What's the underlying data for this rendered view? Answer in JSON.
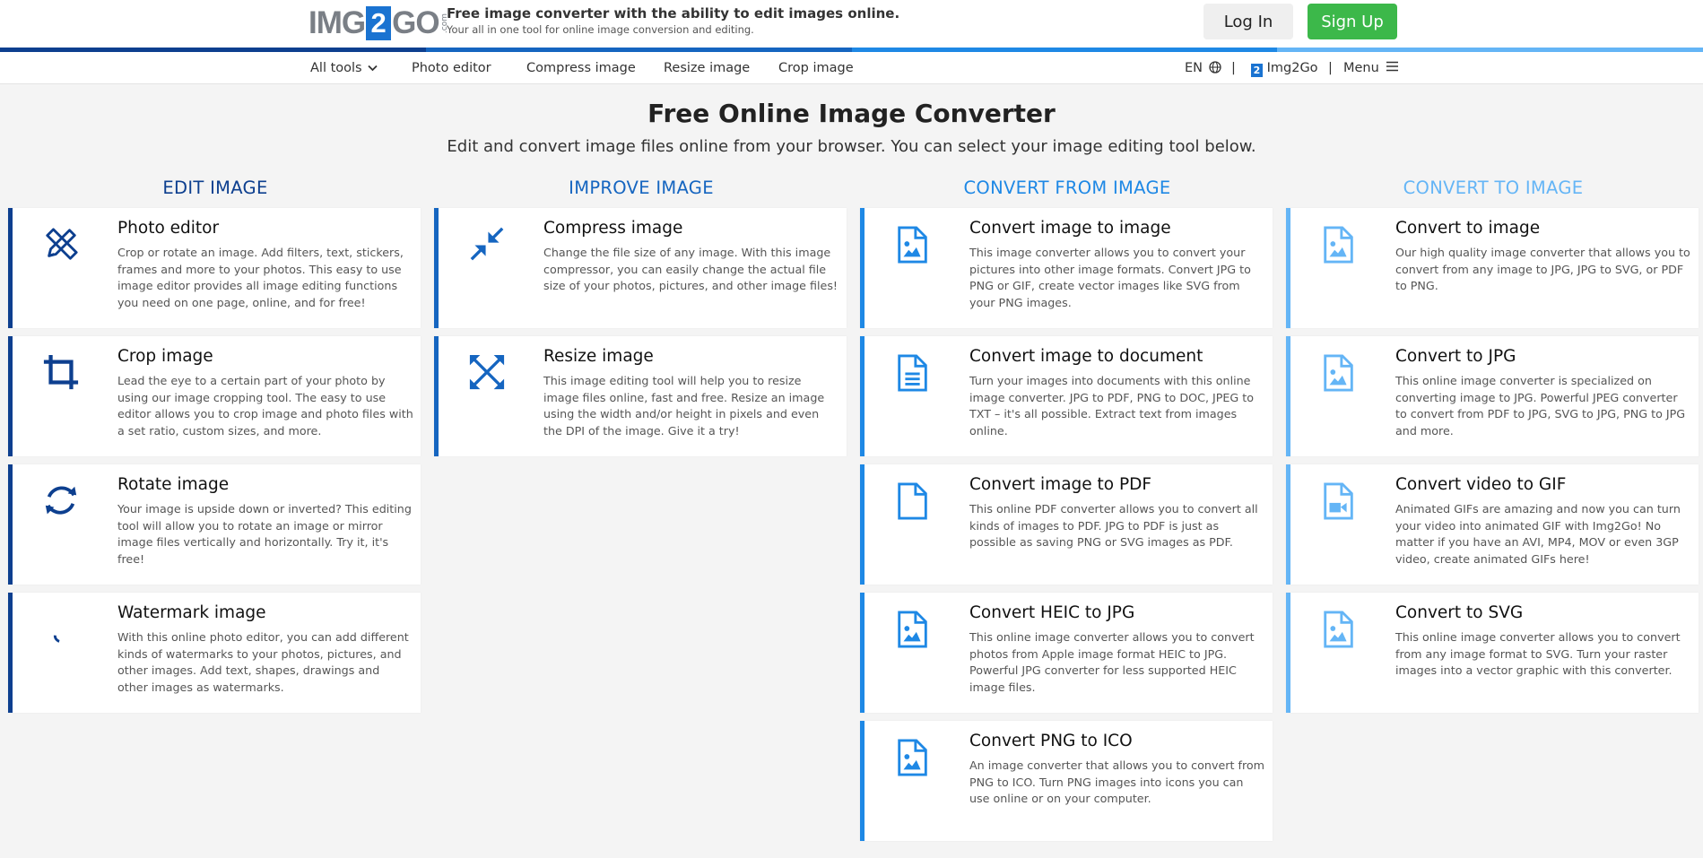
{
  "header": {
    "logo": {
      "pre": "IMG",
      "num": "2",
      "post": "GO",
      "suffix": ".com"
    },
    "tagline_main": "Free image converter with the ability to edit images online.",
    "tagline_sub": "Your all in one tool for online image conversion and editing.",
    "login_label": "Log In",
    "signup_label": "Sign Up"
  },
  "nav": {
    "left": [
      "All tools",
      "Photo editor",
      "Compress image",
      "Resize image",
      "Crop image"
    ],
    "lang": "EN",
    "brand": "Img2Go",
    "menu": "Menu",
    "separator": "|"
  },
  "hero": {
    "title": "Free Online Image Converter",
    "subtitle": "Edit and convert image files online from your browser. You can select your image editing tool below."
  },
  "colors": {
    "edit": "#0d3f8f",
    "improve": "#1565c0",
    "convert_from": "#1e88e5",
    "convert_to": "#64b5f6",
    "signup": "#3cb84a"
  },
  "columns": [
    {
      "heading": "EDIT IMAGE",
      "cards": [
        {
          "title": "Photo editor",
          "icon": "pencil-ruler-icon",
          "desc": "Crop or rotate an image. Add filters, text, stickers, frames and more to your photos. This easy to use image editor provides all image editing functions you need on one page, online, and for free!"
        },
        {
          "title": "Crop image",
          "icon": "crop-icon",
          "desc": "Lead the eye to a certain part of your photo by using our image cropping tool. The easy to use editor allows you to crop image and photo files with a set ratio, custom sizes, and more."
        },
        {
          "title": "Rotate image",
          "icon": "rotate-icon",
          "desc": "Your image is upside down or inverted? This editing tool will allow you to rotate an image or mirror image files vertically and horizontally. Try it, it's free!"
        },
        {
          "title": "Watermark image",
          "icon": "droplet-icon",
          "desc": "With this online photo editor, you can add different kinds of watermarks to your photos, pictures, and other images. Add text, shapes, drawings and other images as watermarks."
        }
      ]
    },
    {
      "heading": "IMPROVE IMAGE",
      "cards": [
        {
          "title": "Compress image",
          "icon": "compress-arrows-icon",
          "desc": "Change the file size of any image. With this image compressor, you can easily change the actual file size of your photos, pictures, and other image files!"
        },
        {
          "title": "Resize image",
          "icon": "expand-arrows-icon",
          "desc": "This image editing tool will help you to resize image files online, fast and free. Resize an image using the width and/or height in pixels and even the DPI of the image. Give it a try!"
        }
      ]
    },
    {
      "heading": "CONVERT FROM IMAGE",
      "cards": [
        {
          "title": "Convert image to image",
          "icon": "image-file-icon",
          "desc": "This image converter allows you to convert your pictures into other image formats. Convert JPG to PNG or GIF, create vector images like SVG from your PNG images."
        },
        {
          "title": "Convert image to document",
          "icon": "document-file-icon",
          "desc": "Turn your images into documents with this online image converter. JPG to PDF, PNG to DOC, JPEG to TXT – it's all possible. Extract text from images online."
        },
        {
          "title": "Convert image to PDF",
          "icon": "pdf-file-icon",
          "desc": "This online PDF converter allows you to convert all kinds of images to PDF. JPG to PDF is just as possible as saving PNG or SVG images as PDF."
        },
        {
          "title": "Convert HEIC to JPG",
          "icon": "image-file-icon",
          "desc": "This online image converter allows you to convert photos from Apple image format HEIC to JPG. Powerful JPG converter for less supported HEIC image files."
        },
        {
          "title": "Convert PNG to ICO",
          "icon": "image-file-icon",
          "desc": "An image converter that allows you to convert from PNG to ICO. Turn PNG images into icons you can use online or on your computer."
        }
      ]
    },
    {
      "heading": "CONVERT TO IMAGE",
      "cards": [
        {
          "title": "Convert to image",
          "icon": "image-file-icon",
          "desc": "Our high quality image converter that allows you to convert from any image to JPG, JPG to SVG, or PDF to PNG."
        },
        {
          "title": "Convert to JPG",
          "icon": "image-file-icon",
          "desc": "This online image converter is specialized on converting image to JPG. Powerful JPEG converter to convert from PDF to JPG, SVG to JPG, PNG to JPG and more."
        },
        {
          "title": "Convert video to GIF",
          "icon": "video-file-icon",
          "desc": "Animated GIFs are amazing and now you can turn your video into animated GIF with Img2Go! No matter if you have an AVI, MP4, MOV or even 3GP video, create animated GIFs here!"
        },
        {
          "title": "Convert to SVG",
          "icon": "image-file-icon",
          "desc": "This online image converter allows you to convert from any image format to SVG. Turn your raster images into a vector graphic with this converter."
        }
      ]
    }
  ]
}
